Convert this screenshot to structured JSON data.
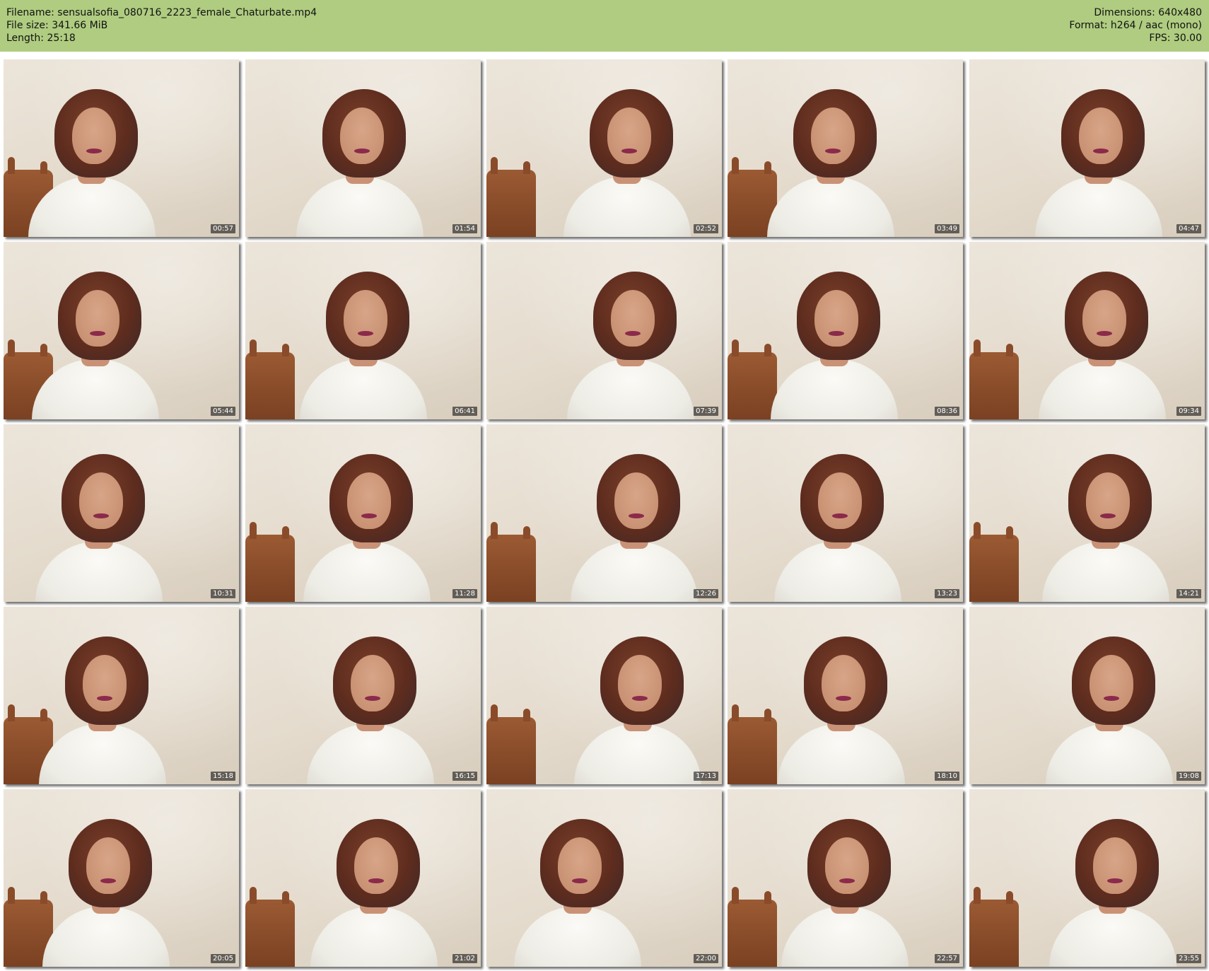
{
  "header": {
    "filename_line": "Filename: sensualsofia_080716_2223_female_Chaturbate.mp4",
    "filesize_line": "File size: 341.66 MiB",
    "length_line": "Length: 25:18",
    "dimensions_line": "Dimensions: 640x480",
    "format_line": "Format: h264 / aac (mono)",
    "fps_line": "FPS: 30.00",
    "background_color": "#afcc80"
  },
  "thumbnails": [
    {
      "timestamp": "00:57"
    },
    {
      "timestamp": "01:54"
    },
    {
      "timestamp": "02:52"
    },
    {
      "timestamp": "03:49"
    },
    {
      "timestamp": "04:47"
    },
    {
      "timestamp": "05:44"
    },
    {
      "timestamp": "06:41"
    },
    {
      "timestamp": "07:39"
    },
    {
      "timestamp": "08:36"
    },
    {
      "timestamp": "09:34"
    },
    {
      "timestamp": "10:31"
    },
    {
      "timestamp": "11:28"
    },
    {
      "timestamp": "12:26"
    },
    {
      "timestamp": "13:23"
    },
    {
      "timestamp": "14:21"
    },
    {
      "timestamp": "15:18"
    },
    {
      "timestamp": "16:15"
    },
    {
      "timestamp": "17:13"
    },
    {
      "timestamp": "18:10"
    },
    {
      "timestamp": "19:08"
    },
    {
      "timestamp": "20:05"
    },
    {
      "timestamp": "21:02"
    },
    {
      "timestamp": "22:00"
    },
    {
      "timestamp": "22:57"
    },
    {
      "timestamp": "23:55"
    }
  ]
}
